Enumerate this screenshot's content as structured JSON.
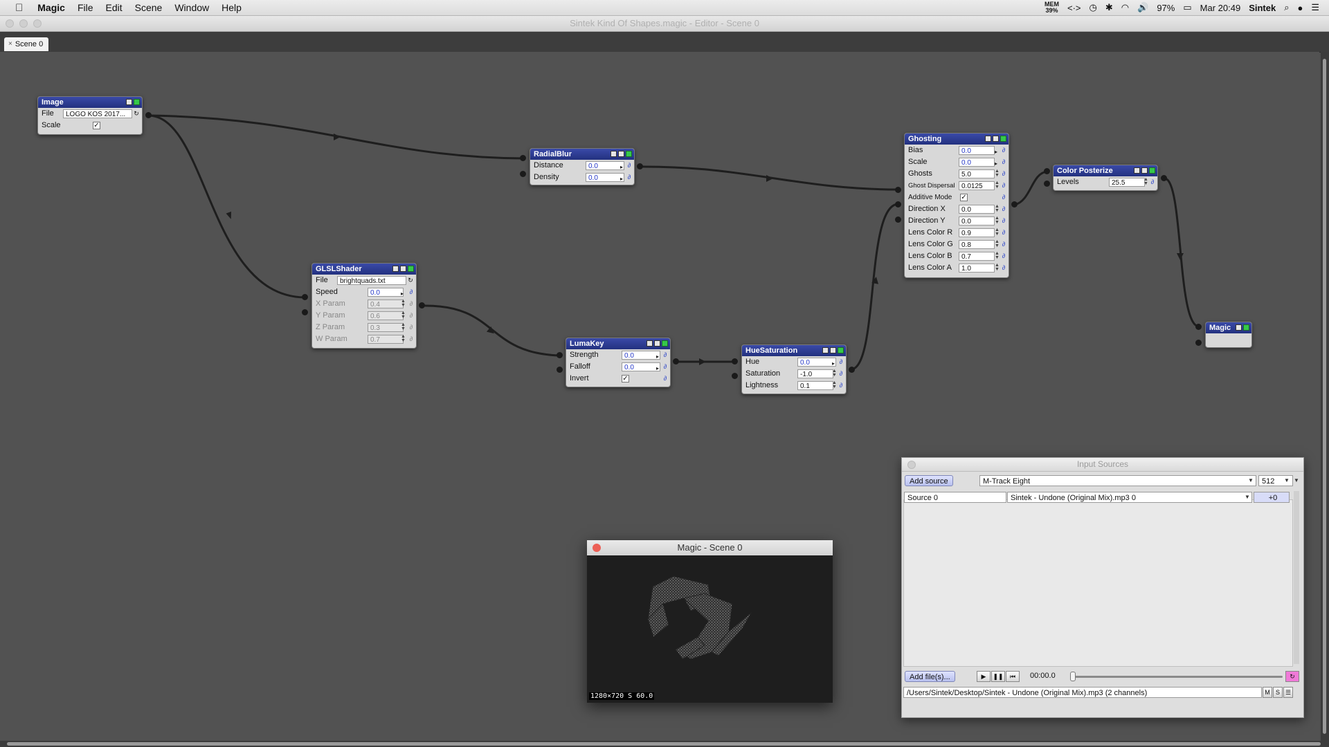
{
  "menubar": {
    "app": "Magic",
    "items": [
      "File",
      "Edit",
      "Scene",
      "Window",
      "Help"
    ],
    "mem_label": "MEM",
    "mem_value": "39%",
    "battery": "97%",
    "clock": "Mar 20:49",
    "user": "Sintek"
  },
  "window": {
    "title": "Sintek Kind Of Shapes.magic - Editor - Scene 0"
  },
  "tabs": [
    {
      "label": "Scene 0",
      "close": "×"
    }
  ],
  "nodes": {
    "image": {
      "title": "Image",
      "file_label": "File",
      "file_value": "LOGO KOS 2017...",
      "scale_label": "Scale",
      "scale_check": "✓"
    },
    "radialblur": {
      "title": "RadialBlur",
      "params": [
        {
          "label": "Distance",
          "value": "0.0"
        },
        {
          "label": "Density",
          "value": "0.0"
        }
      ]
    },
    "ghosting": {
      "title": "Ghosting",
      "params": [
        {
          "label": "Bias",
          "value": "0.0"
        },
        {
          "label": "Scale",
          "value": "0.0"
        },
        {
          "label": "Ghosts",
          "value": "5.0"
        },
        {
          "label": "Ghost Dispersal",
          "value": "0.0125"
        },
        {
          "label": "Additive Mode",
          "value": "✓"
        },
        {
          "label": "Direction X",
          "value": "0.0"
        },
        {
          "label": "Direction Y",
          "value": "0.0"
        },
        {
          "label": "Lens Color R",
          "value": "0.9"
        },
        {
          "label": "Lens Color G",
          "value": "0.8"
        },
        {
          "label": "Lens Color B",
          "value": "0.7"
        },
        {
          "label": "Lens Color A",
          "value": "1.0"
        }
      ]
    },
    "posterize": {
      "title": "Color Posterize",
      "params": [
        {
          "label": "Levels",
          "value": "25.5"
        }
      ]
    },
    "glsl": {
      "title": "GLSLShader",
      "file_label": "File",
      "file_value": "brightquads.txt",
      "params": [
        {
          "label": "Speed",
          "value": "0.0"
        },
        {
          "label": "X Param",
          "value": "0.4"
        },
        {
          "label": "Y Param",
          "value": "0.6"
        },
        {
          "label": "Z Param",
          "value": "0.3"
        },
        {
          "label": "W Param",
          "value": "0.7"
        }
      ]
    },
    "lumakey": {
      "title": "LumaKey",
      "params": [
        {
          "label": "Strength",
          "value": "0.0"
        },
        {
          "label": "Falloff",
          "value": "0.0"
        },
        {
          "label": "Invert",
          "value": "✓"
        }
      ]
    },
    "huesat": {
      "title": "HueSaturation",
      "params": [
        {
          "label": "Hue",
          "value": "0.0"
        },
        {
          "label": "Saturation",
          "value": "-1.0"
        },
        {
          "label": "Lightness",
          "value": "0.1"
        }
      ]
    },
    "magic": {
      "title": "Magic"
    }
  },
  "preview": {
    "title": "Magic - Scene 0",
    "status": "1280×720 S 60.0"
  },
  "input_sources": {
    "title": "Input Sources",
    "add_source": "Add source",
    "device": "M-Track Eight",
    "buffer": "512",
    "source_name": "Source 0",
    "source_file": "Sintek - Undone (Original Mix).mp3 0",
    "gain": "+0",
    "add_files": "Add file(s)...",
    "time": "00:00.0",
    "path": "/Users/Sintek/Desktop/Sintek - Undone (Original Mix).mp3 (2 channels)",
    "m_label": "M",
    "s_label": "S"
  },
  "colors": {
    "node_header": "#2b3990",
    "canvas": "#525252",
    "accent_green": "#35c84a",
    "value_text": "#2336c8"
  }
}
